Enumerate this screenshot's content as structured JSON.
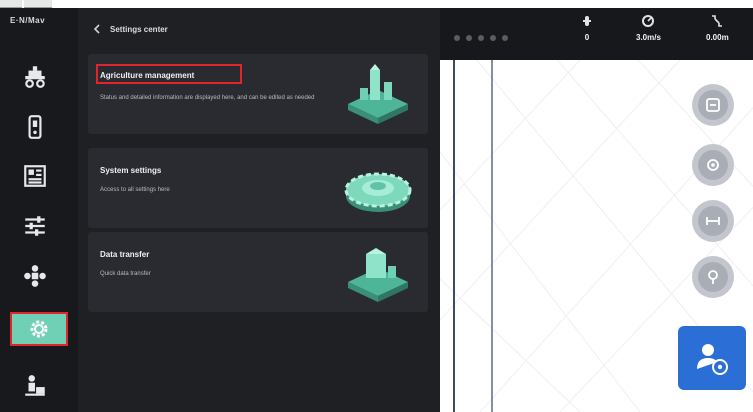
{
  "app": {
    "brand": "E·N/Mav"
  },
  "sidebar": {
    "items": [
      {
        "name": "sidebar-item-farm",
        "icon": "tractor-icon",
        "active": false
      },
      {
        "name": "sidebar-item-device",
        "icon": "device-icon",
        "active": false
      },
      {
        "name": "sidebar-item-data",
        "icon": "grid-icon",
        "active": false
      },
      {
        "name": "sidebar-item-adjust",
        "icon": "sliders-icon",
        "active": false
      },
      {
        "name": "sidebar-item-drone",
        "icon": "drone-icon",
        "active": false
      },
      {
        "name": "sidebar-item-settings",
        "icon": "gear-icon",
        "active": true
      },
      {
        "name": "sidebar-item-upload",
        "icon": "upload-icon",
        "active": false
      }
    ]
  },
  "panel": {
    "title": "Settings center",
    "cards": [
      {
        "title": "Agriculture management",
        "description": "Status and detailed information are displayed here, and can be edited as needed"
      },
      {
        "title": "System settings",
        "description": "Access to all settings here"
      },
      {
        "title": "Data transfer",
        "description": "Quick data transfer"
      }
    ]
  },
  "status": {
    "stats": [
      {
        "icon": "satellite-icon",
        "value": "0"
      },
      {
        "icon": "speed-icon",
        "value": "3.0m/s"
      },
      {
        "icon": "distance-icon",
        "value": "0.00m"
      }
    ]
  },
  "map_controls": [
    {
      "name": "map-button-layers",
      "icon": "layers-icon"
    },
    {
      "name": "map-button-locate",
      "icon": "locate-icon"
    },
    {
      "name": "map-button-measure",
      "icon": "measure-icon"
    },
    {
      "name": "map-button-align",
      "icon": "align-icon"
    }
  ],
  "colors": {
    "accent": "#6fd0b6",
    "highlight": "#e0262c",
    "primary": "#2b6fd6"
  }
}
